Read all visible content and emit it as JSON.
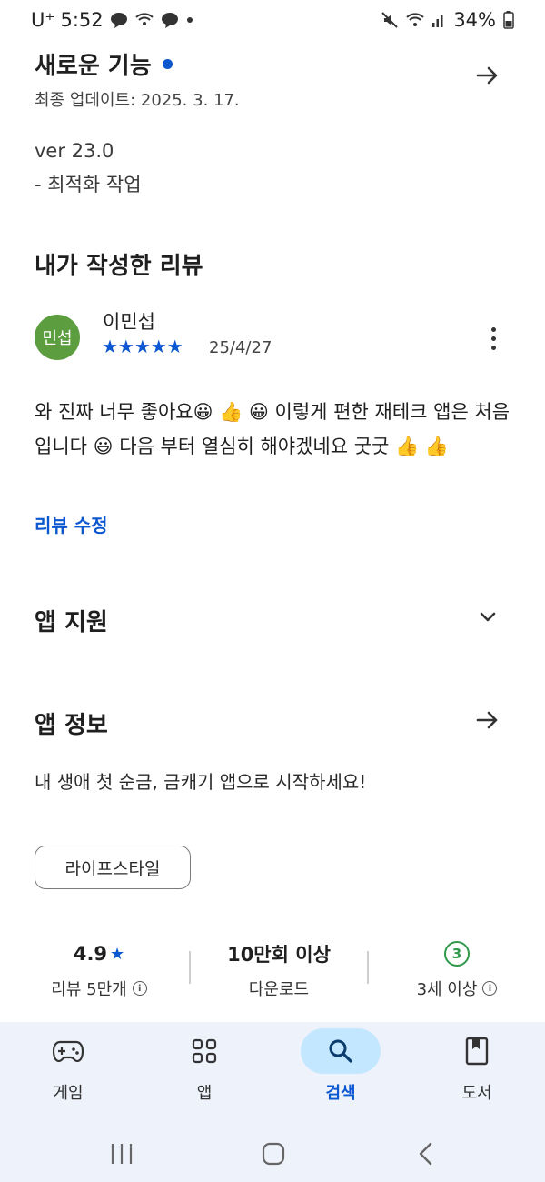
{
  "status_bar": {
    "carrier": "U⁺",
    "time": "5:52",
    "battery": "34%",
    "icons": [
      "chat-bubble-icon",
      "wifi-calling-icon",
      "chat-bubble-icon",
      "dot-icon",
      "mute-icon",
      "wifi-icon",
      "signal-icon",
      "battery-icon"
    ]
  },
  "whats_new": {
    "title": "새로운 기능",
    "updated": "최종 업데이트: 2025. 3. 17.",
    "version": "ver 23.0",
    "note": "- 최적화 작업"
  },
  "my_review": {
    "title": "내가 작성한 리뷰",
    "avatar_text": "민섭",
    "reviewer": "이민섭",
    "stars": "★★★★★",
    "rating": 5,
    "date": "25/4/27",
    "text": "와 진짜 너무 좋아요😀 👍 😀 이렇게 편한 재테크 앱은 처음 입니다 😃 다음 부터 열심히 해야겠네요 굿굿 👍 👍",
    "edit_label": "리뷰 수정"
  },
  "app_support": {
    "title": "앱 지원"
  },
  "app_info": {
    "title": "앱 정보",
    "tagline": "내 생애 첫 순금, 금캐기 앱으로 시작하세요!",
    "category": "라이프스타일"
  },
  "stats": {
    "rating": "4.9",
    "rating_star": "★",
    "reviews": "리뷰 5만개",
    "downloads": "10만회 이상",
    "downloads_label": "다운로드",
    "age_badge": "3",
    "age_label": "3세 이상"
  },
  "bottom_nav": {
    "items": [
      {
        "label": "게임",
        "icon": "gamepad-icon",
        "active": false
      },
      {
        "label": "앱",
        "icon": "apps-grid-icon",
        "active": false
      },
      {
        "label": "검색",
        "icon": "search-icon",
        "active": true
      },
      {
        "label": "도서",
        "icon": "book-icon",
        "active": false
      }
    ]
  },
  "colors": {
    "accent": "#0b57d0",
    "avatar": "#5c9d3f",
    "age_badge": "#2e9a4a",
    "nav_bg": "#eef3fb",
    "nav_pill": "#c2e7ff"
  }
}
